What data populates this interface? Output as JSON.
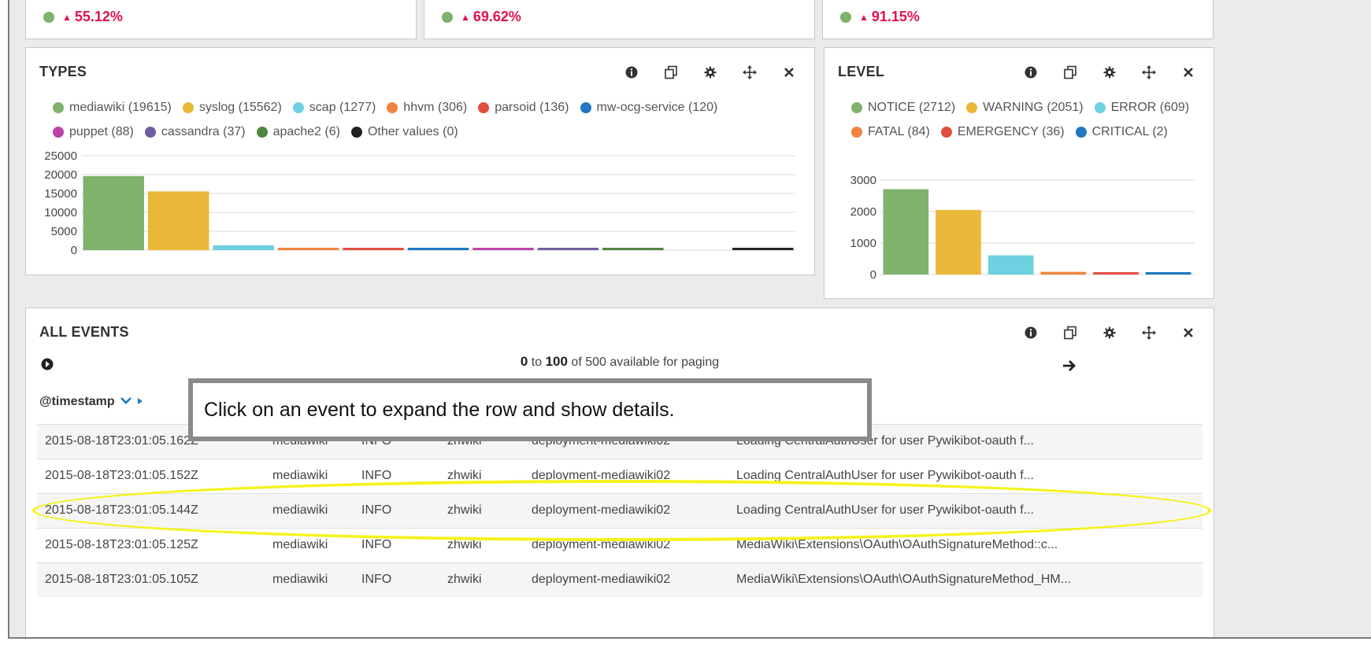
{
  "metrics": [
    {
      "value": "55.12%",
      "trend": "up",
      "dot_color": "#7eb26d"
    },
    {
      "value": "69.62%",
      "trend": "up",
      "dot_color": "#7eb26d"
    },
    {
      "value": "91.15%",
      "trend": "up",
      "dot_color": "#7eb26d"
    }
  ],
  "row_strip_colors": [
    "#ef843c",
    "#6ed0e0",
    "#1f78c1",
    "#ef843c",
    "#56c443"
  ],
  "types_panel": {
    "title": "TYPES",
    "tools": [
      "info-icon",
      "copy-icon",
      "gear-icon",
      "move-icon",
      "close-icon"
    ],
    "legend": [
      {
        "label": "mediawiki (19615)",
        "color": "#7eb26d"
      },
      {
        "label": "syslog (15562)",
        "color": "#eab839"
      },
      {
        "label": "scap (1277)",
        "color": "#6ed0e0"
      },
      {
        "label": "hhvm (306)",
        "color": "#ef843c"
      },
      {
        "label": "parsoid (136)",
        "color": "#e24d42"
      },
      {
        "label": "mw-ocg-service (120)",
        "color": "#1f78c1"
      },
      {
        "label": "puppet (88)",
        "color": "#ba43a9"
      },
      {
        "label": "cassandra (37)",
        "color": "#705da0"
      },
      {
        "label": "apache2 (6)",
        "color": "#508642"
      },
      {
        "label": "Other values (0)",
        "color": "#222222"
      }
    ]
  },
  "level_panel": {
    "title": "LEVEL",
    "tools": [
      "info-icon",
      "copy-icon",
      "gear-icon",
      "move-icon",
      "close-icon"
    ],
    "legend": [
      {
        "label": "NOTICE (2712)",
        "color": "#7eb26d"
      },
      {
        "label": "WARNING (2051)",
        "color": "#eab839"
      },
      {
        "label": "ERROR (609)",
        "color": "#6ed0e0"
      },
      {
        "label": "FATAL (84)",
        "color": "#ef843c"
      },
      {
        "label": "EMERGENCY (36)",
        "color": "#e24d42"
      },
      {
        "label": "CRITICAL (2)",
        "color": "#1f78c1"
      }
    ]
  },
  "chart_data": [
    {
      "type": "bar",
      "categories": [
        "mediawiki",
        "syslog",
        "scap",
        "hhvm",
        "parsoid",
        "mw-ocg-service",
        "puppet",
        "cassandra",
        "apache2",
        "",
        "Other values"
      ],
      "values": [
        19615,
        15562,
        1277,
        306,
        136,
        120,
        88,
        37,
        6,
        0,
        0
      ],
      "colors": [
        "#7eb26d",
        "#eab839",
        "#6ed0e0",
        "#ef843c",
        "#e24d42",
        "#1f78c1",
        "#ba43a9",
        "#705da0",
        "#508642",
        "#ffffff",
        "#222222"
      ],
      "yticks": [
        "25000",
        "20000",
        "15000",
        "10000",
        "5000",
        "0"
      ],
      "ylim": [
        0,
        25000
      ],
      "grid": true
    },
    {
      "type": "bar",
      "categories": [
        "NOTICE",
        "WARNING",
        "ERROR",
        "FATAL",
        "EMERGENCY",
        "CRITICAL"
      ],
      "values": [
        2712,
        2051,
        609,
        84,
        36,
        2
      ],
      "colors": [
        "#7eb26d",
        "#eab839",
        "#6ed0e0",
        "#ef843c",
        "#e24d42",
        "#1f78c1"
      ],
      "yticks": [
        "3000",
        "2000",
        "1000",
        "0"
      ],
      "ylim": [
        0,
        3000
      ],
      "grid": true
    }
  ],
  "events_panel": {
    "title": "ALL EVENTS",
    "paging": {
      "from": "0",
      "to_word": "to",
      "to": "100",
      "suffix": "of 500 available for paging"
    },
    "sort_column": "@timestamp",
    "rows": [
      {
        "timestamp": "2015-08-18T23:01:05.162Z",
        "type": "mediawiki",
        "level": "INFO",
        "wiki": "zhwiki",
        "host": "deployment-mediawiki02",
        "message": "Loading CentralAuthUser for user Pywikibot-oauth f..."
      },
      {
        "timestamp": "2015-08-18T23:01:05.152Z",
        "type": "mediawiki",
        "level": "INFO",
        "wiki": "zhwiki",
        "host": "deployment-mediawiki02",
        "message": "Loading CentralAuthUser for user Pywikibot-oauth f..."
      },
      {
        "timestamp": "2015-08-18T23:01:05.144Z",
        "type": "mediawiki",
        "level": "INFO",
        "wiki": "zhwiki",
        "host": "deployment-mediawiki02",
        "message": "Loading CentralAuthUser for user Pywikibot-oauth f..."
      },
      {
        "timestamp": "2015-08-18T23:01:05.125Z",
        "type": "mediawiki",
        "level": "INFO",
        "wiki": "zhwiki",
        "host": "deployment-mediawiki02",
        "message": "MediaWiki\\Extensions\\OAuth\\OAuthSignatureMethod::c..."
      },
      {
        "timestamp": "2015-08-18T23:01:05.105Z",
        "type": "mediawiki",
        "level": "INFO",
        "wiki": "zhwiki",
        "host": "deployment-mediawiki02",
        "message": "MediaWiki\\Extensions\\OAuth\\OAuthSignatureMethod_HM..."
      }
    ]
  },
  "tooltip": {
    "text": "Click on an event to expand the row and show details."
  }
}
